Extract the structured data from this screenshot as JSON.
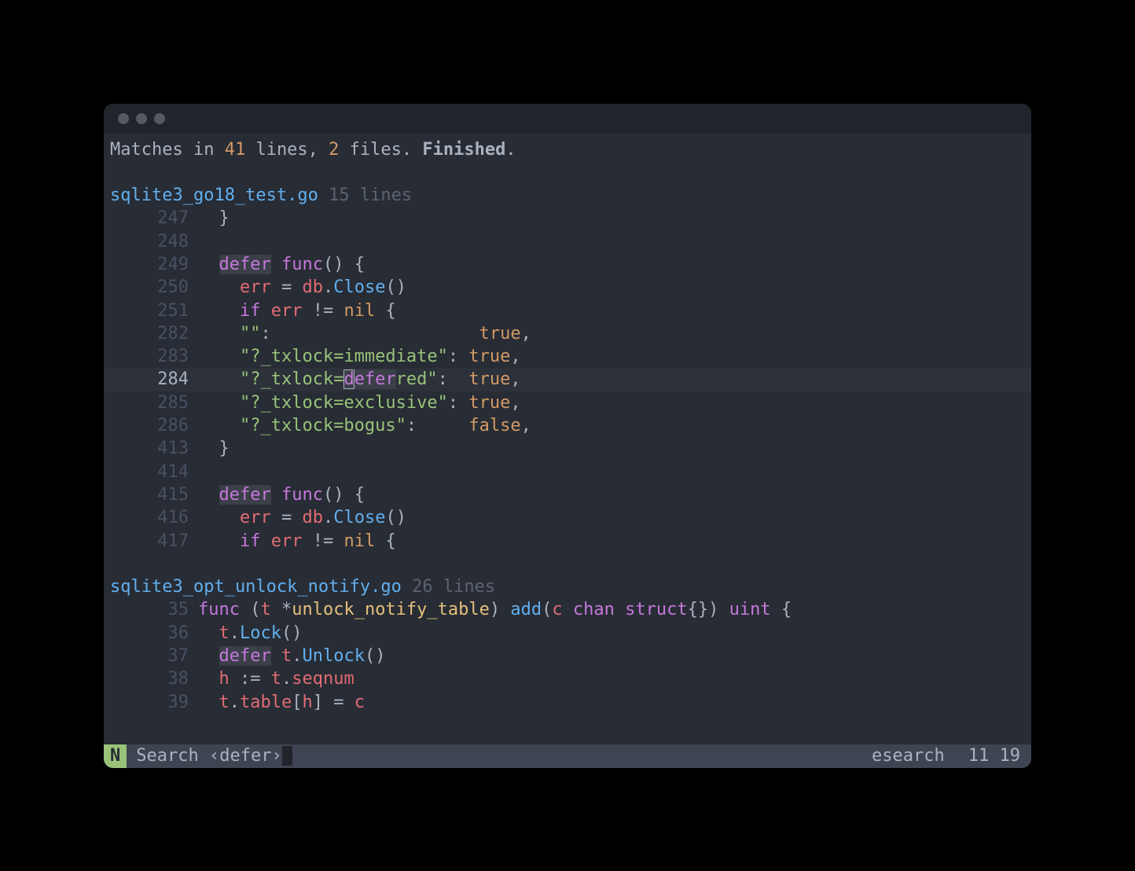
{
  "summary": {
    "prefix": "Matches in ",
    "line_count": "41",
    "mid1": " lines, ",
    "file_count": "2",
    "mid2": " files. ",
    "status": "Finished",
    "suffix": "."
  },
  "files": [
    {
      "name": "sqlite3_go18_test.go",
      "line_count_label": "15 lines",
      "lines": [
        {
          "num": "247",
          "tokens": [
            {
              "t": "  ",
              "c": "c-text"
            },
            {
              "t": "}",
              "c": "c-text"
            }
          ]
        },
        {
          "num": "248",
          "tokens": []
        },
        {
          "num": "249",
          "tokens": [
            {
              "t": "  ",
              "c": "c-text"
            },
            {
              "t": "defer",
              "c": "hl-match"
            },
            {
              "t": " ",
              "c": "c-text"
            },
            {
              "t": "func",
              "c": "c-purple"
            },
            {
              "t": "() {",
              "c": "c-text"
            }
          ]
        },
        {
          "num": "250",
          "tokens": [
            {
              "t": "    ",
              "c": "c-text"
            },
            {
              "t": "err",
              "c": "c-red"
            },
            {
              "t": " = ",
              "c": "c-text"
            },
            {
              "t": "db",
              "c": "c-red"
            },
            {
              "t": ".",
              "c": "c-text"
            },
            {
              "t": "Close",
              "c": "c-blue"
            },
            {
              "t": "()",
              "c": "c-text"
            }
          ]
        },
        {
          "num": "251",
          "tokens": [
            {
              "t": "    ",
              "c": "c-text"
            },
            {
              "t": "if",
              "c": "c-purple"
            },
            {
              "t": " ",
              "c": "c-text"
            },
            {
              "t": "err",
              "c": "c-red"
            },
            {
              "t": " != ",
              "c": "c-text"
            },
            {
              "t": "nil",
              "c": "c-orange"
            },
            {
              "t": " {",
              "c": "c-text"
            }
          ]
        },
        {
          "num": "282",
          "tokens": [
            {
              "t": "    ",
              "c": "c-text"
            },
            {
              "t": "\"\"",
              "c": "c-green"
            },
            {
              "t": ":                    ",
              "c": "c-text"
            },
            {
              "t": "true",
              "c": "c-orange"
            },
            {
              "t": ",",
              "c": "c-text"
            }
          ]
        },
        {
          "num": "283",
          "tokens": [
            {
              "t": "    ",
              "c": "c-text"
            },
            {
              "t": "\"?_txlock=immediate\"",
              "c": "c-green"
            },
            {
              "t": ": ",
              "c": "c-text"
            },
            {
              "t": "true",
              "c": "c-orange"
            },
            {
              "t": ",",
              "c": "c-text"
            }
          ]
        },
        {
          "num": "284",
          "active": true,
          "tokens": [
            {
              "t": "    ",
              "c": "c-text"
            },
            {
              "t": "\"?_txlock=",
              "c": "c-green"
            },
            {
              "t": "d",
              "c": "hl-match cursor-box"
            },
            {
              "t": "efer",
              "c": "hl-match"
            },
            {
              "t": "red\"",
              "c": "c-green"
            },
            {
              "t": ":  ",
              "c": "c-text"
            },
            {
              "t": "true",
              "c": "c-orange"
            },
            {
              "t": ",",
              "c": "c-text"
            }
          ]
        },
        {
          "num": "285",
          "tokens": [
            {
              "t": "    ",
              "c": "c-text"
            },
            {
              "t": "\"?_txlock=exclusive\"",
              "c": "c-green"
            },
            {
              "t": ": ",
              "c": "c-text"
            },
            {
              "t": "true",
              "c": "c-orange"
            },
            {
              "t": ",",
              "c": "c-text"
            }
          ]
        },
        {
          "num": "286",
          "tokens": [
            {
              "t": "    ",
              "c": "c-text"
            },
            {
              "t": "\"?_txlock=bogus\"",
              "c": "c-green"
            },
            {
              "t": ":     ",
              "c": "c-text"
            },
            {
              "t": "false",
              "c": "c-orange"
            },
            {
              "t": ",",
              "c": "c-text"
            }
          ]
        },
        {
          "num": "413",
          "tokens": [
            {
              "t": "  ",
              "c": "c-text"
            },
            {
              "t": "}",
              "c": "c-text"
            }
          ]
        },
        {
          "num": "414",
          "tokens": []
        },
        {
          "num": "415",
          "tokens": [
            {
              "t": "  ",
              "c": "c-text"
            },
            {
              "t": "defer",
              "c": "hl-match"
            },
            {
              "t": " ",
              "c": "c-text"
            },
            {
              "t": "func",
              "c": "c-purple"
            },
            {
              "t": "() {",
              "c": "c-text"
            }
          ]
        },
        {
          "num": "416",
          "tokens": [
            {
              "t": "    ",
              "c": "c-text"
            },
            {
              "t": "err",
              "c": "c-red"
            },
            {
              "t": " = ",
              "c": "c-text"
            },
            {
              "t": "db",
              "c": "c-red"
            },
            {
              "t": ".",
              "c": "c-text"
            },
            {
              "t": "Close",
              "c": "c-blue"
            },
            {
              "t": "()",
              "c": "c-text"
            }
          ]
        },
        {
          "num": "417",
          "tokens": [
            {
              "t": "    ",
              "c": "c-text"
            },
            {
              "t": "if",
              "c": "c-purple"
            },
            {
              "t": " ",
              "c": "c-text"
            },
            {
              "t": "err",
              "c": "c-red"
            },
            {
              "t": " != ",
              "c": "c-text"
            },
            {
              "t": "nil",
              "c": "c-orange"
            },
            {
              "t": " {",
              "c": "c-text"
            }
          ]
        }
      ]
    },
    {
      "name": "sqlite3_opt_unlock_notify.go",
      "line_count_label": "26 lines",
      "lines": [
        {
          "num": "35",
          "tokens": [
            {
              "t": "func",
              "c": "c-purple"
            },
            {
              "t": " (",
              "c": "c-text"
            },
            {
              "t": "t",
              "c": "c-red"
            },
            {
              "t": " *",
              "c": "c-text"
            },
            {
              "t": "unlock_notify_table",
              "c": "c-yellow"
            },
            {
              "t": ") ",
              "c": "c-text"
            },
            {
              "t": "add",
              "c": "c-blue"
            },
            {
              "t": "(",
              "c": "c-text"
            },
            {
              "t": "c",
              "c": "c-red"
            },
            {
              "t": " ",
              "c": "c-text"
            },
            {
              "t": "chan",
              "c": "c-purple"
            },
            {
              "t": " ",
              "c": "c-text"
            },
            {
              "t": "struct",
              "c": "c-purple"
            },
            {
              "t": "{}) ",
              "c": "c-text"
            },
            {
              "t": "uint",
              "c": "c-purple"
            },
            {
              "t": " {",
              "c": "c-text"
            }
          ]
        },
        {
          "num": "36",
          "tokens": [
            {
              "t": "  ",
              "c": "c-text"
            },
            {
              "t": "t",
              "c": "c-red"
            },
            {
              "t": ".",
              "c": "c-text"
            },
            {
              "t": "Lock",
              "c": "c-blue"
            },
            {
              "t": "()",
              "c": "c-text"
            }
          ]
        },
        {
          "num": "37",
          "tokens": [
            {
              "t": "  ",
              "c": "c-text"
            },
            {
              "t": "defer",
              "c": "hl-match"
            },
            {
              "t": " ",
              "c": "c-text"
            },
            {
              "t": "t",
              "c": "c-red"
            },
            {
              "t": ".",
              "c": "c-text"
            },
            {
              "t": "Unlock",
              "c": "c-blue"
            },
            {
              "t": "()",
              "c": "c-text"
            }
          ]
        },
        {
          "num": "38",
          "tokens": [
            {
              "t": "  ",
              "c": "c-text"
            },
            {
              "t": "h",
              "c": "c-red"
            },
            {
              "t": " := ",
              "c": "c-text"
            },
            {
              "t": "t",
              "c": "c-red"
            },
            {
              "t": ".",
              "c": "c-text"
            },
            {
              "t": "seqnum",
              "c": "c-red"
            }
          ]
        },
        {
          "num": "39",
          "tokens": [
            {
              "t": "  ",
              "c": "c-text"
            },
            {
              "t": "t",
              "c": "c-red"
            },
            {
              "t": ".",
              "c": "c-text"
            },
            {
              "t": "table",
              "c": "c-red"
            },
            {
              "t": "[",
              "c": "c-text"
            },
            {
              "t": "h",
              "c": "c-red"
            },
            {
              "t": "] = ",
              "c": "c-text"
            },
            {
              "t": "c",
              "c": "c-red"
            }
          ]
        }
      ]
    }
  ],
  "statusbar": {
    "mode": "N",
    "label": "Search",
    "query_open": "‹",
    "query": "defer",
    "query_close": "›",
    "buffer_name": "esearch",
    "position": "11 19"
  }
}
